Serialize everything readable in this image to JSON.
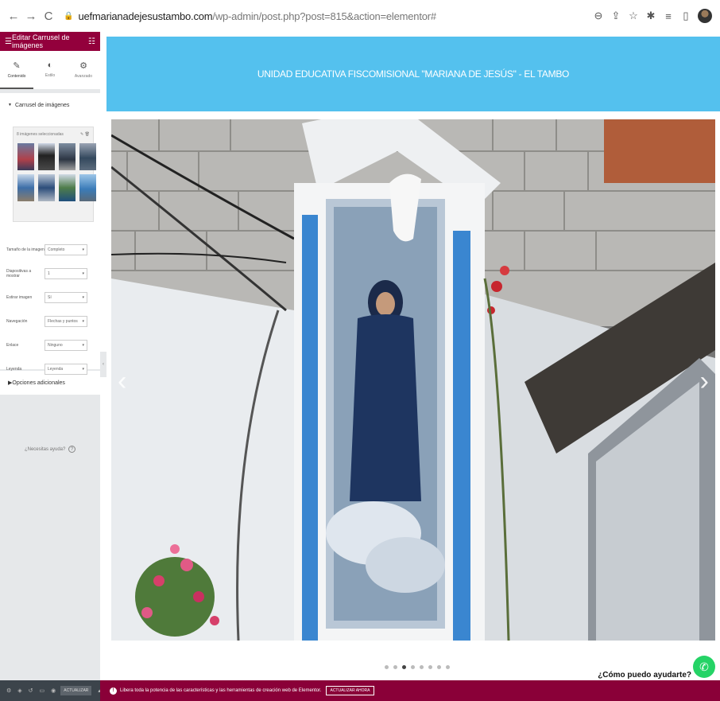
{
  "browser": {
    "url_host": "uefmarianadejesustambo.com",
    "url_path": "/wp-admin/post.php?post=815&action=elementor#",
    "back_icon": "arrow-left-icon",
    "forward_icon": "arrow-right-icon",
    "reload_icon": "reload-icon"
  },
  "panel": {
    "title": "Editar Carrusel de imágenes",
    "tabs": [
      {
        "label": "Contenido",
        "icon": "pencil-icon"
      },
      {
        "label": "Estilo",
        "icon": "contrast-icon"
      },
      {
        "label": "Avanzado",
        "icon": "gear-icon"
      }
    ],
    "section_title": "Carrusel de imágenes",
    "gallery_label": "8 imágenes seleccionadas",
    "fields": [
      {
        "label": "Tamaño de la imagen",
        "value": "Completo"
      },
      {
        "label": "Diapositivas a mostrar",
        "value": "1"
      },
      {
        "label": "Estirar imagen",
        "value": "Sí"
      },
      {
        "label": "Navegación",
        "value": "Flechas y puntos"
      },
      {
        "label": "Enlace",
        "value": "Ninguno"
      },
      {
        "label": "Leyenda",
        "value": "Leyenda"
      }
    ],
    "additional_options": "Opciones adicionales",
    "help_text": "¿Necesitas ayuda?"
  },
  "footer": {
    "update_label": "ACTUALIZAR",
    "promo_text": "Libera toda la potencia de las características y las herramientas de creación web de Elementor.",
    "upgrade_label": "ACTUALIZAR AHORA"
  },
  "site": {
    "header_title": "UNIDAD EDUCATIVA FISCOMISIONAL \"MARIANA DE JESÚS\" - EL TAMBO",
    "chat_prompt": "¿Cómo puedo ayudarte?",
    "slider_total": 8,
    "slider_active": 3
  },
  "colors": {
    "header_blue": "#54c1ee",
    "elementor_red": "#93003c",
    "whatsapp_green": "#25d366"
  }
}
